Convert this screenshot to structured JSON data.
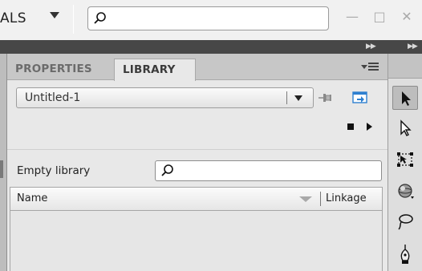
{
  "app_bar": {
    "workspace_label": "ALS",
    "search_placeholder": "",
    "window_controls": {
      "minimize": "—",
      "maximize": "□",
      "close": "✕"
    }
  },
  "panel": {
    "tabs": [
      {
        "label": "PROPERTIES",
        "active": false
      },
      {
        "label": "LIBRARY",
        "active": true
      }
    ],
    "document_select": {
      "value": "Untitled-1"
    },
    "empty_label": "Empty library",
    "search_placeholder": "",
    "list": {
      "columns": [
        "Name",
        "Linkage"
      ],
      "rows": []
    }
  },
  "tools": [
    {
      "name": "selection-tool",
      "active": true
    },
    {
      "name": "subselection-tool",
      "active": false
    },
    {
      "name": "free-transform-tool",
      "active": false
    },
    {
      "name": "3d-rotation-tool",
      "active": false
    },
    {
      "name": "lasso-tool",
      "active": false
    },
    {
      "name": "pen-tool",
      "active": false
    }
  ],
  "colors": {
    "dark_strip": "#474747",
    "panel_bg": "#e8e8e8",
    "tab_bar": "#c7c7c7",
    "accent_blue": "#2d7fd0"
  }
}
